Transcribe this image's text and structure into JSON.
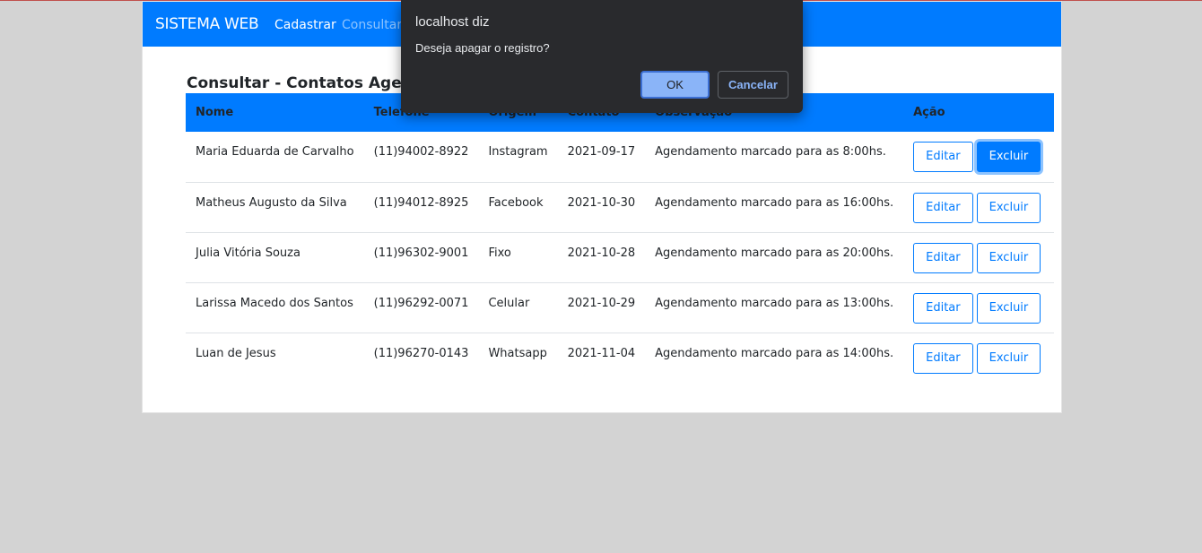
{
  "navbar": {
    "brand": "SISTEMA WEB",
    "links": [
      "Cadastrar",
      "Consultar"
    ]
  },
  "page": {
    "title": "Consultar - Contatos Agendados"
  },
  "table": {
    "headers": [
      "Nome",
      "Telefone",
      "Origem",
      "Contato",
      "Observação",
      "Ação"
    ],
    "rows": [
      {
        "nome": "Maria Eduarda de Carvalho",
        "telefone": "(11)94002-8922",
        "origem": "Instagram",
        "contato": "2021-09-17",
        "observacao": "Agendamento marcado para as 8:00hs."
      },
      {
        "nome": "Matheus Augusto da Silva",
        "telefone": "(11)94012-8925",
        "origem": "Facebook",
        "contato": "2021-10-30",
        "observacao": "Agendamento marcado para as 16:00hs."
      },
      {
        "nome": "Julia Vitória Souza",
        "telefone": "(11)96302-9001",
        "origem": "Fixo",
        "contato": "2021-10-28",
        "observacao": "Agendamento marcado para as 20:00hs."
      },
      {
        "nome": "Larissa Macedo dos Santos",
        "telefone": "(11)96292-0071",
        "origem": "Celular",
        "contato": "2021-10-29",
        "observacao": "Agendamento marcado para as 13:00hs."
      },
      {
        "nome": "Luan de Jesus",
        "telefone": "(11)96270-0143",
        "origem": "Whatsapp",
        "contato": "2021-11-04",
        "observacao": "Agendamento marcado para as 14:00hs."
      }
    ],
    "edit_label": "Editar",
    "delete_label": "Excluir"
  },
  "dialog": {
    "title": "localhost diz",
    "message": "Deseja apagar o registro?",
    "ok_label": "OK",
    "cancel_label": "Cancelar"
  },
  "colors": {
    "primary": "#007bff",
    "background": "#d3d3d3",
    "dialog_bg": "#292a2d",
    "dialog_accent": "#8ab4f8"
  }
}
